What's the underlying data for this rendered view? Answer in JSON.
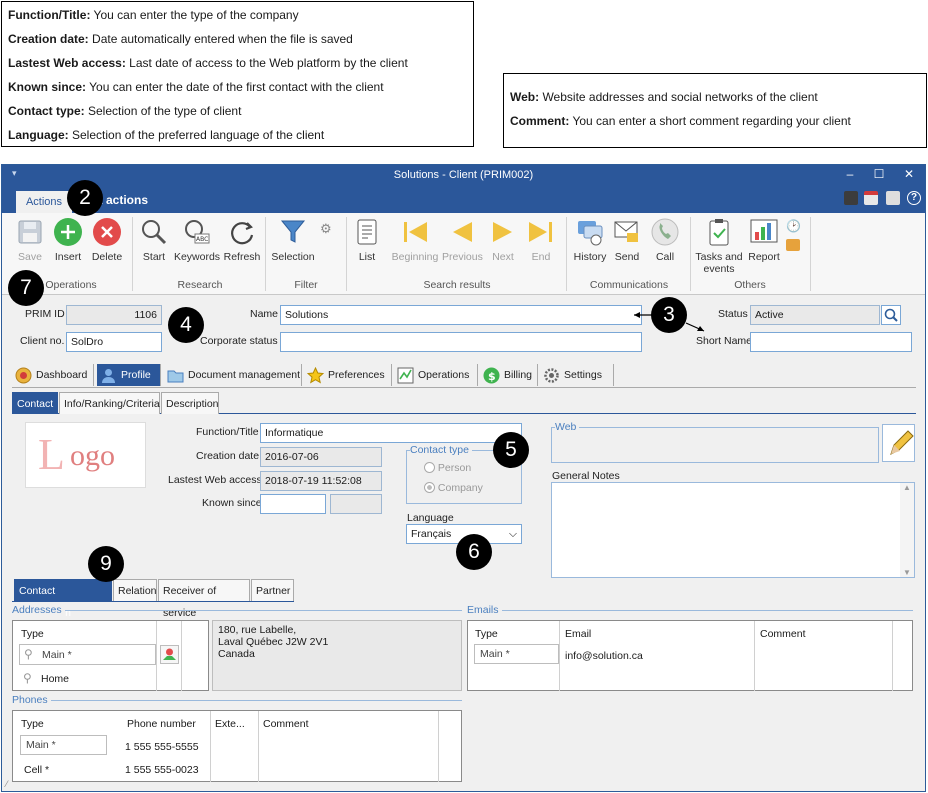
{
  "callouts": {
    "left": [
      {
        "term": "Function/Title:",
        "desc": " You can enter the type of the company"
      },
      {
        "term": "Creation date:",
        "desc": " Date automatically entered when the file is saved"
      },
      {
        "term": "Lastest Web access:",
        "desc": " Last date of access to the Web platform by the client"
      },
      {
        "term": "Known since:",
        "desc": " You can enter the date of the first contact with the client"
      },
      {
        "term": "Contact type:",
        "desc": " Selection of the type of client"
      },
      {
        "term": "Language:",
        "desc": " Selection of the preferred language of the client"
      }
    ],
    "right": [
      {
        "term": "Web:",
        "desc": " Website addresses and social networks of the client"
      },
      {
        "term": "Comment:",
        "desc": " You can enter a short comment regarding your client"
      }
    ]
  },
  "badges": [
    "2",
    "7",
    "4",
    "3",
    "5",
    "6",
    "9"
  ],
  "window": {
    "title": "Solutions - Client (PRIM002)",
    "controls": {
      "minimize": "–",
      "maximize": "☐",
      "close": "✕"
    },
    "ribbon_tabs": {
      "active": "Actions",
      "other_partial": "k actions"
    }
  },
  "ribbon": {
    "buttons": {
      "save": "Save",
      "insert": "Insert",
      "delete": "Delete",
      "start": "Start",
      "keywords": "Keywords",
      "refresh": "Refresh",
      "selection": "Selection",
      "list": "List",
      "beginning": "Beginning",
      "previous": "Previous",
      "next": "Next",
      "end": "End",
      "history": "History",
      "send": "Send",
      "call": "Call",
      "tasks_events": "Tasks and events",
      "report": "Report"
    },
    "groups": {
      "operations": "Operations",
      "research": "Research",
      "filter": "Filter",
      "search_results": "Search results",
      "communications": "Communications",
      "others": "Others"
    }
  },
  "header_form": {
    "prim_id_label": "PRIM ID",
    "prim_id": "1106",
    "client_no_label": "Client no.",
    "client_no": "SolDro",
    "name_label": "Name",
    "name": "Solutions",
    "corporate_status_label": "Corporate status",
    "corporate_status": "",
    "status_label": "Status",
    "status": "Active",
    "short_name_label": "Short Name",
    "short_name": ""
  },
  "main_tabs": [
    "Dashboard",
    "Profile",
    "Document management",
    "Preferences",
    "Operations",
    "Billing",
    "Settings"
  ],
  "sub_tabs": [
    "Contact",
    "Info/Ranking/Criteria",
    "Description"
  ],
  "logo_text": {
    "l": "L",
    "rest": "ogo"
  },
  "contact": {
    "function_title_label": "Function/Title",
    "function_title": "Informatique",
    "creation_date_label": "Creation date",
    "creation_date": "2016-07-06",
    "web_access_label": "Lastest Web access",
    "web_access": "2018-07-19 11:52:08",
    "known_since_label": "Known since",
    "known_since": "",
    "contact_type_title": "Contact type",
    "contact_type_options": [
      "Person",
      "Company"
    ],
    "language_label": "Language",
    "language": "Français",
    "web_title": "Web",
    "general_notes_label": "General Notes"
  },
  "bottom_tabs": [
    "Contact information",
    "Relation",
    "Receiver of service",
    "Partner"
  ],
  "addresses": {
    "title": "Addresses",
    "type_header": "Type",
    "rows": [
      "Main *",
      "Home"
    ],
    "address_lines": [
      "180, rue Labelle,",
      "Laval Québec J2W 2V1",
      "Canada"
    ]
  },
  "emails": {
    "title": "Emails",
    "headers": [
      "Type",
      "Email",
      "Comment"
    ],
    "rows": [
      {
        "type": "Main *",
        "email": "info@solution.ca",
        "comment": ""
      }
    ]
  },
  "phones": {
    "title": "Phones",
    "headers": [
      "Type",
      "Phone number",
      "Exte...",
      "Comment"
    ],
    "rows": [
      {
        "type": "Main *",
        "number": "1 555 555-5555"
      },
      {
        "type": "Cell *",
        "number": "1 555 555-0023"
      }
    ]
  },
  "colors": {
    "titlebar": "#2b579a",
    "accent": "#2b579a",
    "insert_green": "#3fb34f",
    "delete_red": "#e24b4b"
  }
}
